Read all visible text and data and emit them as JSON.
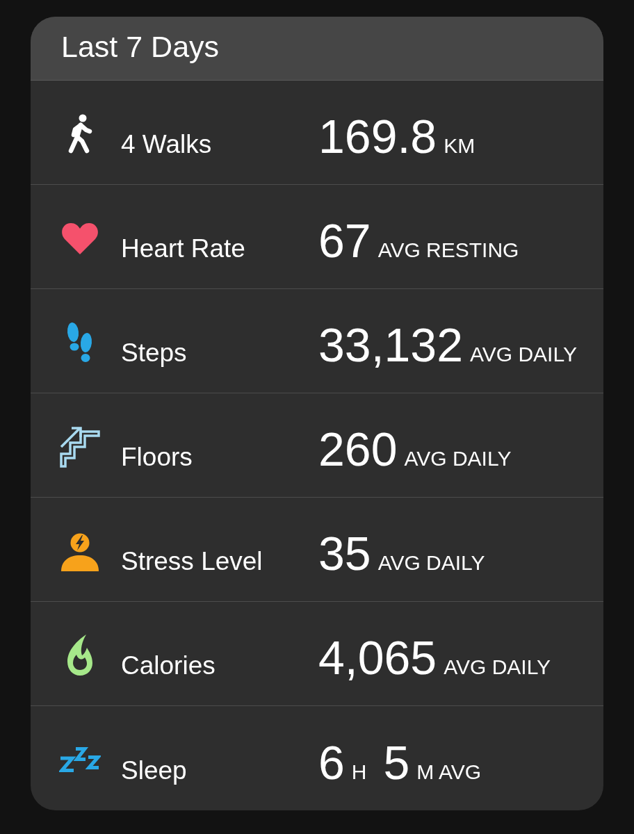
{
  "card": {
    "title": "Last 7 Days",
    "rows": [
      {
        "kind": "walk",
        "label": "4 Walks",
        "value": [
          {
            "kind": "number",
            "text": "169.8"
          },
          {
            "kind": "unit",
            "text": "KM"
          }
        ]
      },
      {
        "kind": "heart",
        "label": "Heart Rate",
        "value": [
          {
            "kind": "number",
            "text": "67"
          },
          {
            "kind": "unit",
            "text": "AVG RESTING"
          }
        ]
      },
      {
        "kind": "steps",
        "label": "Steps",
        "value": [
          {
            "kind": "number",
            "text": "33,132"
          },
          {
            "kind": "unit",
            "text": "AVG DAILY"
          }
        ]
      },
      {
        "kind": "stairs",
        "label": "Floors",
        "value": [
          {
            "kind": "number",
            "text": "260"
          },
          {
            "kind": "unit",
            "text": "AVG DAILY"
          }
        ]
      },
      {
        "kind": "stress",
        "label": "Stress Level",
        "value": [
          {
            "kind": "number",
            "text": "35"
          },
          {
            "kind": "unit",
            "text": "AVG DAILY"
          }
        ]
      },
      {
        "kind": "flame",
        "label": "Calories",
        "value": [
          {
            "kind": "number",
            "text": "4,065"
          },
          {
            "kind": "unit",
            "text": "AVG DAILY"
          }
        ]
      },
      {
        "kind": "sleep",
        "label": "Sleep",
        "value": [
          {
            "kind": "number",
            "text": "6"
          },
          {
            "kind": "unit",
            "text": "H"
          },
          {
            "kind": "number",
            "text": "5"
          },
          {
            "kind": "unit",
            "text": "M AVG"
          }
        ]
      }
    ]
  }
}
